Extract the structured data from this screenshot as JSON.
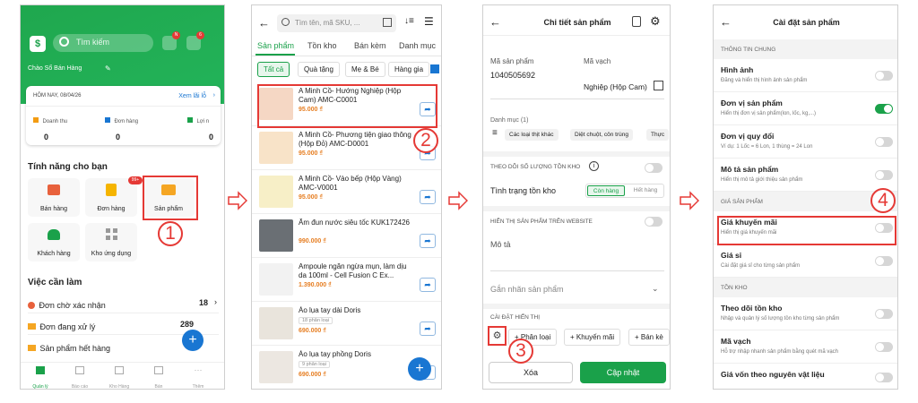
{
  "s1": {
    "search_placeholder": "Tìm kiếm",
    "greeting": "Chào Sổ Bán Hàng",
    "badge_n": "N",
    "badge_6": "6",
    "today_label": "HÔM NAY, 08/04/26",
    "view_report": "Xem lãi lỗ",
    "stats": [
      {
        "label": "Doanh thu",
        "value": "0"
      },
      {
        "label": "Đơn hàng",
        "value": "0"
      },
      {
        "label": "Lợi n",
        "value": "0"
      }
    ],
    "features_title": "Tính năng cho bạn",
    "features": [
      "Bán hàng",
      "Đơn hàng",
      "Sản phẩm",
      "Khách hàng",
      "Kho ứng dụng"
    ],
    "orders_badge": "99+",
    "tasks_title": "Việc cần làm",
    "tasks": [
      {
        "label": "Đơn chờ xác nhận",
        "count": "18"
      },
      {
        "label": "Đơn đang xử lý",
        "count": "289"
      },
      {
        "label": "Sản phẩm hết hàng",
        "count": ""
      }
    ],
    "nav": [
      "Quản lý",
      "Báo cáo",
      "Kho Hàng",
      "Bán",
      "Thêm"
    ],
    "step": "1"
  },
  "s2": {
    "search_placeholder": "Tìm tên, mã SKU, ...",
    "tabs": [
      "Sản phẩm",
      "Tồn kho",
      "Bán kèm",
      "Danh mục"
    ],
    "chips": [
      "Tất cả",
      "Quà tặng",
      "Mẹ & Bé",
      "Hàng gia"
    ],
    "products": [
      {
        "name": "A Minh Cồ- Hướng Nghiệp (Hộp Cam) AMC-C0001",
        "price": "95.000 ₫",
        "tag": ""
      },
      {
        "name": "A Minh Cồ- Phương tiện giao thông (Hộp Đỏ) AMC-D0001",
        "price": "95.000 ₫",
        "tag": ""
      },
      {
        "name": "A Minh Cồ- Vào bếp (Hộp Vàng) AMC-V0001",
        "price": "95.000 ₫",
        "tag": ""
      },
      {
        "name": "Ấm đun nước siêu tốc KUK172426",
        "price": "990.000 ₫",
        "tag": ""
      },
      {
        "name": "Ampoule ngăn ngừa mụn, làm dịu da 100ml - Cell Fusion C Ex...",
        "price": "1.390.000 ₫",
        "tag": ""
      },
      {
        "name": "Áo lụa tay dài Doris",
        "price": "690.000 ₫",
        "tag": "18 phân loại"
      },
      {
        "name": "Áo lụa tay phồng Doris",
        "price": "690.000 ₫",
        "tag": "9 phân loại"
      }
    ],
    "step": "2"
  },
  "s3": {
    "title": "Chi tiết sản phẩm",
    "code_label": "Mã sản phẩm",
    "code_value": "1040505692",
    "barcode_label": "Mã vạch",
    "barcode_value": "Nghiệp (Hộp Cam)",
    "category_label": "Danh mục (1)",
    "categories": [
      "Các loại thịt khác",
      "Diệt chuột, côn trùng",
      "Thực"
    ],
    "stock_track": "THEO DÕI SỐ LƯỢNG TỒN KHO",
    "stock_status": "Tình trạng tồn kho",
    "stock_opts": [
      "Còn hàng",
      "Hết hàng"
    ],
    "website_label": "HIỂN THỊ SẢN PHẨM TRÊN WEBSITE",
    "desc_label": "Mô tả",
    "tag_label": "Gắn nhãn sản phẩm",
    "display_label": "CÀI ĐẶT HIỂN THỊ",
    "display_btns": [
      "+ Phân loại",
      "+ Khuyến mãi",
      "+ Bán kè"
    ],
    "delete": "Xóa",
    "update": "Cập nhật",
    "step": "3"
  },
  "s4": {
    "title": "Cài đặt sản phẩm",
    "sections": [
      {
        "header": "THÔNG TIN CHUNG",
        "items": [
          {
            "title": "Hình ảnh",
            "sub": "Đăng và hiển thị hình ảnh sản phẩm",
            "on": false
          },
          {
            "title": "Đơn vị sản phẩm",
            "sub": "Hiển thị đơn vị sản phẩm(lon, lốc, kg,...)",
            "on": true
          },
          {
            "title": "Đơn vị quy đổi",
            "sub": "Ví dụ: 1 Lốc = 6 Lon, 1 thùng = 24 Lon",
            "on": false
          },
          {
            "title": "Mô tả sản phẩm",
            "sub": "Hiển thị mô tả giới thiệu sản phẩm",
            "on": false
          }
        ]
      },
      {
        "header": "GIÁ SẢN PHẨM",
        "items": [
          {
            "title": "Giá khuyến mãi",
            "sub": "Hiển thị giá khuyến mãi",
            "on": false
          },
          {
            "title": "Giá sỉ",
            "sub": "Cài đặt giá sỉ cho từng sản phẩm",
            "on": false
          }
        ]
      },
      {
        "header": "TỒN KHO",
        "items": [
          {
            "title": "Theo dõi tồn kho",
            "sub": "Nhập và quản lý số lượng tồn kho từng sản phẩm",
            "on": false
          },
          {
            "title": "Mã vạch",
            "sub": "Hỗ trợ nhập nhanh sản phẩm bằng quét mã vạch",
            "on": false
          },
          {
            "title": "Giá vốn theo nguyên vật liệu",
            "sub": "",
            "on": false
          }
        ]
      }
    ],
    "step": "4"
  }
}
